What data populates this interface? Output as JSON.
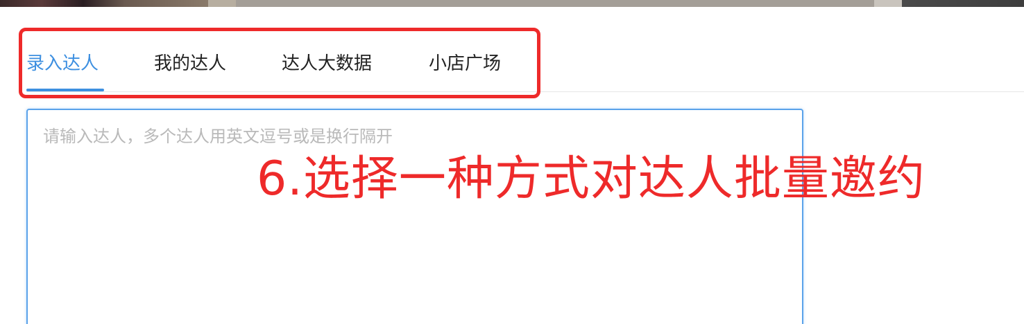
{
  "tabs": [
    {
      "label": "录入达人",
      "active": true
    },
    {
      "label": "我的达人",
      "active": false
    },
    {
      "label": "达人大数据",
      "active": false
    },
    {
      "label": "小店广场",
      "active": false
    }
  ],
  "input": {
    "placeholder": "请输入达人，多个达人用英文逗号或是换行隔开",
    "value": ""
  },
  "annotation": {
    "text": "6.选择一种方式对达人批量邀约"
  },
  "colors": {
    "accent": "#3d8fe0",
    "annotation": "#ee2a2a"
  }
}
